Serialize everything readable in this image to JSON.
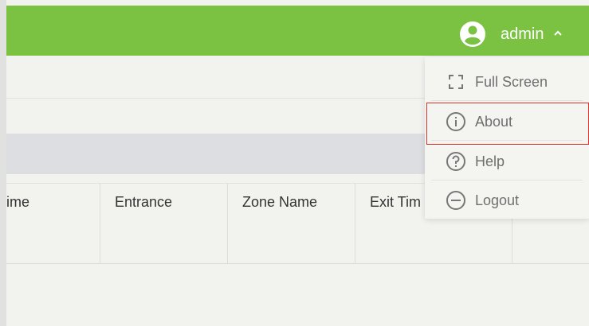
{
  "header": {
    "username": "admin",
    "user_icon": "user-circle-icon",
    "chevron": "^",
    "colors": {
      "bar": "#7bc242",
      "text": "#ffffff"
    }
  },
  "table": {
    "columns": [
      "ime",
      "Entrance",
      "Zone Name",
      "Exit Tim",
      ""
    ]
  },
  "user_dropdown": {
    "items": [
      {
        "label": "Full Screen",
        "icon": "fullscreen-icon"
      },
      {
        "label": "About",
        "icon": "info-icon",
        "highlighted": true
      },
      {
        "label": "Help",
        "icon": "help-icon"
      },
      {
        "label": "Logout",
        "icon": "logout-icon"
      }
    ],
    "highlight_color": "#d9312a"
  }
}
